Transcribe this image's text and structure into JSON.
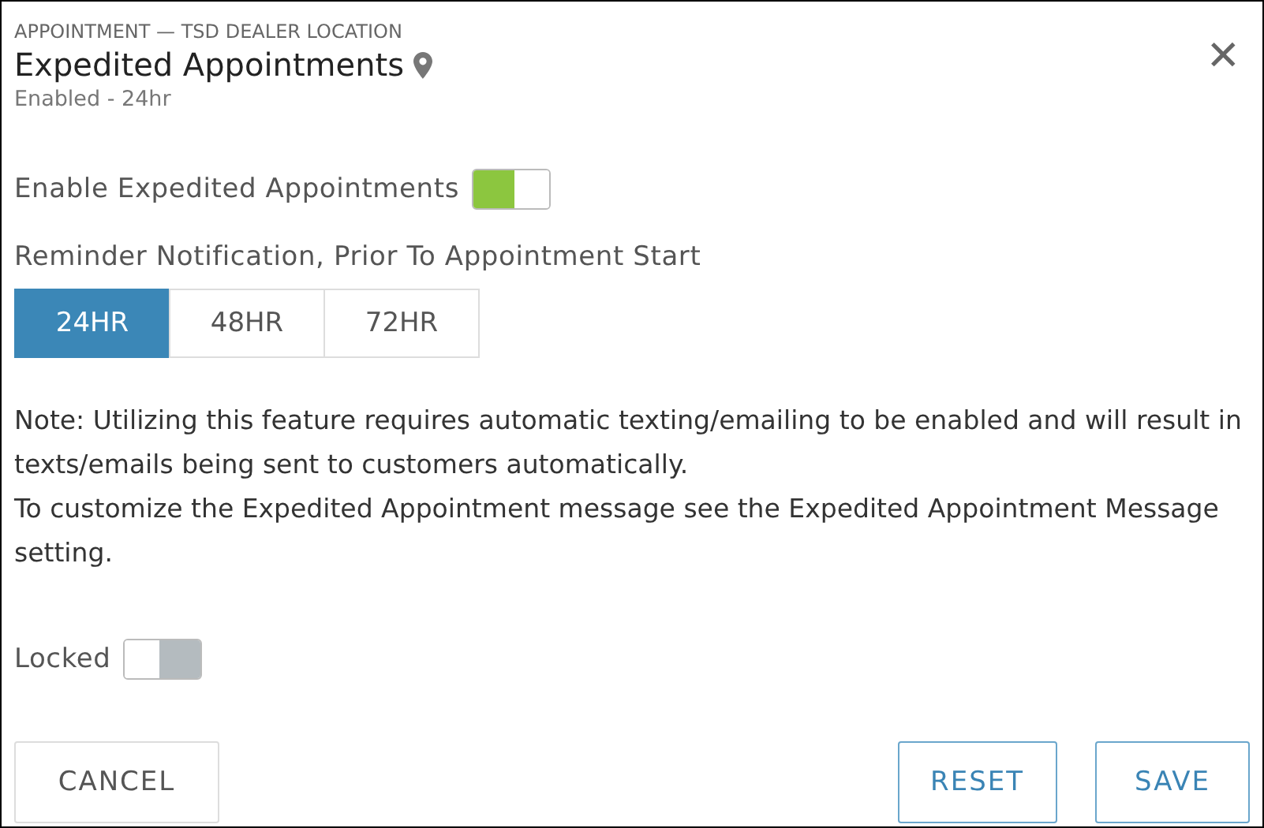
{
  "header": {
    "breadcrumb": "APPOINTMENT — TSD DEALER LOCATION",
    "title": "Expedited Appointments",
    "subtitle": "Enabled - 24hr",
    "close": "✕"
  },
  "enable_toggle": {
    "label": "Enable Expedited Appointments",
    "on": true
  },
  "reminder": {
    "label": "Reminder Notification, Prior To Appointment Start",
    "options": [
      {
        "label": "24HR",
        "selected": true
      },
      {
        "label": "48HR",
        "selected": false
      },
      {
        "label": "72HR",
        "selected": false
      }
    ]
  },
  "notes": [
    "Note: Utilizing this feature requires automatic texting/emailing to be enabled and will result in texts/emails being sent to customers automatically.",
    "To customize the Expedited Appointment message see the Expedited Appointment Message setting."
  ],
  "locked_toggle": {
    "label": "Locked",
    "on": false
  },
  "buttons": [
    {
      "label": "CANCEL",
      "kind": "plain"
    },
    {
      "label": "RESET",
      "kind": "outline"
    },
    {
      "label": "SAVE",
      "kind": "outline"
    }
  ]
}
